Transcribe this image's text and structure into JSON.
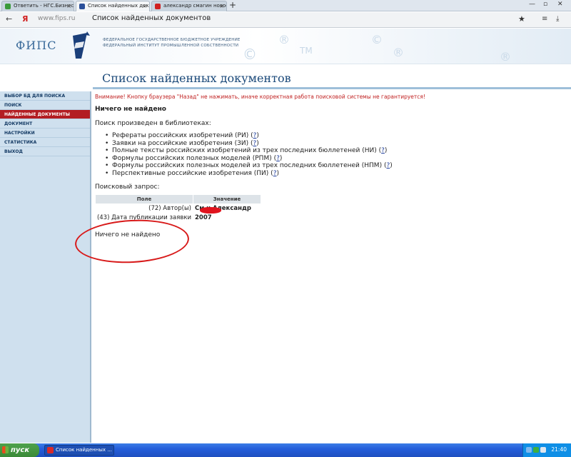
{
  "browser": {
    "tabs": [
      {
        "title": "Ответить - НГС.Бизнес с",
        "fav": "#3a9a3a",
        "active": false
      },
      {
        "title": "Список найденных док",
        "fav": "#2a4f9a",
        "active": true
      },
      {
        "title": "александр смагин новосибирск",
        "fav": "#d02020",
        "active": false
      }
    ],
    "url": "www.fips.ru",
    "page_title": "Список найденных документов",
    "back_icon": "back-arrow-icon",
    "yandex_icon": "Я"
  },
  "banner": {
    "logo_text": "ФИПС",
    "org_line1": "ФЕДЕРАЛЬНОЕ ГОСУДАРСТВЕННОЕ БЮДЖЕТНОЕ УЧРЕЖДЕНИЕ",
    "org_line2": "ФЕДЕРАЛЬНЫЙ ИНСТИТУТ ПРОМЫШЛЕННОЙ СОБСТВЕННОСТИ"
  },
  "sidebar": {
    "items": [
      {
        "label": "ВЫБОР БД ДЛЯ ПОИСКА"
      },
      {
        "label": "ПОИСК"
      },
      {
        "label": "НАЙДЕННЫЕ ДОКУМЕНТЫ"
      },
      {
        "label": "ДОКУМЕНТ"
      },
      {
        "label": "НАСТРОЙКИ"
      },
      {
        "label": "СТАТИСТИКА"
      },
      {
        "label": "ВЫХОД"
      }
    ],
    "active_index": 2
  },
  "main": {
    "title": "Список найденных документов",
    "warning": "Внимание! Кнопку браузера \"Назад\" не нажимать, иначе корректная работа поисковой системы не гарантируется!",
    "nothing_found": "Ничего не найдено",
    "libs_intro": "Поиск произведен в библиотеках:",
    "libraries": [
      "Рефераты российских изобретений (РИ)",
      "Заявки на российские изобретения (ЗИ)",
      "Полные тексты российских изобретений из трех последних бюллетеней (НИ)",
      "Формулы российских полезных моделей (РПМ)",
      "Формулы российских полезных моделей из трех последних бюллетеней (НПМ)",
      "Перспективные российские изобретения (ПИ)"
    ],
    "help_label": "?",
    "query_label": "Поисковый запрос:",
    "query_table": {
      "headers": [
        "Поле",
        "Значение"
      ],
      "rows": [
        {
          "field": "(72) Автор(ы)",
          "value": "См    н Александр"
        },
        {
          "field": "(43) Дата публикации заявки",
          "value": "2007"
        }
      ]
    },
    "nothing_found_2": "Ничего не найдено"
  },
  "taskbar": {
    "start_label": "пуск",
    "task_label": "Список найденных ...",
    "clock": "21:40"
  }
}
